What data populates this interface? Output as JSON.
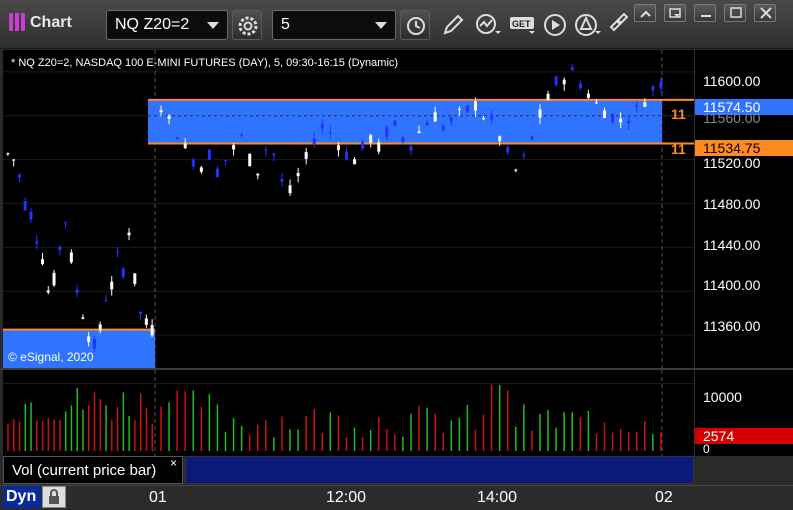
{
  "window": {
    "title": "Chart"
  },
  "toolbar": {
    "symbol": "NQ Z20=2",
    "interval": "5",
    "icons": [
      "settings-gear-icon",
      "clock-icon",
      "pencil-draw-icon",
      "study-indicator-icon",
      "get-data-icon",
      "play-icon",
      "alert-triangle-icon",
      "link-chain-icon"
    ],
    "get_label": "GET"
  },
  "chart": {
    "caption": "* NQ Z20=2, NASDAQ 100 E-MINI FUTURES (DAY), 5, 09:30-16:15 (Dynamic)",
    "watermark": "© eSignal, 2020",
    "price_ticks": [
      "11600.00",
      "11560.00",
      "11520.00",
      "11480.00",
      "11440.00",
      "11400.00",
      "11360.00"
    ],
    "upper_line_label": "11",
    "lower_line_label": "11",
    "last_price": "11574.50",
    "hidden_price": "11560.00",
    "line_price": "11534.75",
    "colors": {
      "up": "#ffffff",
      "down": "#2233ff",
      "range": "#2f73ff",
      "line": "#ff8a1f"
    }
  },
  "volume": {
    "tick_10000": "10000",
    "tick_0": "0",
    "last_value": "2574",
    "legend": "Vol (current price bar)",
    "close_glyph": "×"
  },
  "timebar": {
    "labels": [
      "01",
      "12:00",
      "14:00",
      "02"
    ],
    "dynamic": "Dyn"
  },
  "chart_data": {
    "type": "candlestick",
    "title": "* NQ Z20=2, NASDAQ 100 E-MINI FUTURES (DAY), 5, 09:30-16:15 (Dynamic)",
    "ylim": [
      11330,
      11620
    ],
    "horizontal_lines": [
      11574.5,
      11534.75
    ],
    "session1_line": 11365,
    "x": [
      "01",
      "12:00",
      "14:00",
      "02"
    ],
    "volume_ylim": [
      0,
      12000
    ]
  }
}
